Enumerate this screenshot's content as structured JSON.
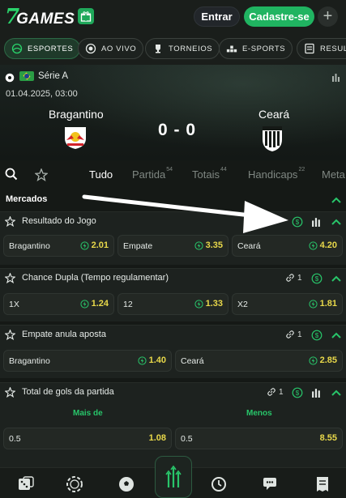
{
  "header": {
    "logo_seven": "7",
    "logo_games": "GAMES",
    "login_label": "Entrar",
    "signup_label": "Cadastre-se",
    "plus_label": "+"
  },
  "categories": [
    {
      "label": "ESPORTES",
      "icon": "sport-icon",
      "active": true
    },
    {
      "label": "AO VIVO",
      "icon": "live-icon",
      "active": false
    },
    {
      "label": "TORNEIOS",
      "icon": "trophy-icon",
      "active": false
    },
    {
      "label": "E-SPORTS",
      "icon": "gamepad-icon",
      "active": false
    },
    {
      "label": "RESUL",
      "icon": "results-icon",
      "active": false
    }
  ],
  "match": {
    "league": "Série A",
    "date": "01.04.2025, 03:00",
    "home": "Bragantino",
    "away": "Ceará",
    "score": "0 - 0"
  },
  "tabs": [
    {
      "label": "Tudo",
      "count": ""
    },
    {
      "label": "Partida",
      "count": "54"
    },
    {
      "label": "Totais",
      "count": "44"
    },
    {
      "label": "Handicaps",
      "count": "22"
    },
    {
      "label": "Meta",
      "count": ""
    }
  ],
  "markets_title": "Mercados",
  "markets": [
    {
      "name": "Resultado do Jogo",
      "link": "",
      "odds": [
        {
          "label": "Bragantino",
          "value": "2.01"
        },
        {
          "label": "Empate",
          "value": "3.35"
        },
        {
          "label": "Ceará",
          "value": "4.20"
        }
      ]
    },
    {
      "name": "Chance Dupla (Tempo regulamentar)",
      "link": "1",
      "odds": [
        {
          "label": "1X",
          "value": "1.24"
        },
        {
          "label": "12",
          "value": "1.33"
        },
        {
          "label": "X2",
          "value": "1.81"
        }
      ]
    },
    {
      "name": "Empate anula aposta",
      "link": "1",
      "odds": [
        {
          "label": "Bragantino",
          "value": "1.40"
        },
        {
          "label": "Ceará",
          "value": "2.85"
        }
      ]
    },
    {
      "name": "Total de gols da partida",
      "link": "1",
      "columns": [
        "Mais de",
        "Menos"
      ],
      "odds": [
        {
          "label": "0.5",
          "value": "1.08"
        },
        {
          "label": "0.5",
          "value": "8.55"
        }
      ]
    }
  ],
  "colors": {
    "accent": "#20b461",
    "odd_value": "#e8d84a",
    "background": "#151916"
  }
}
